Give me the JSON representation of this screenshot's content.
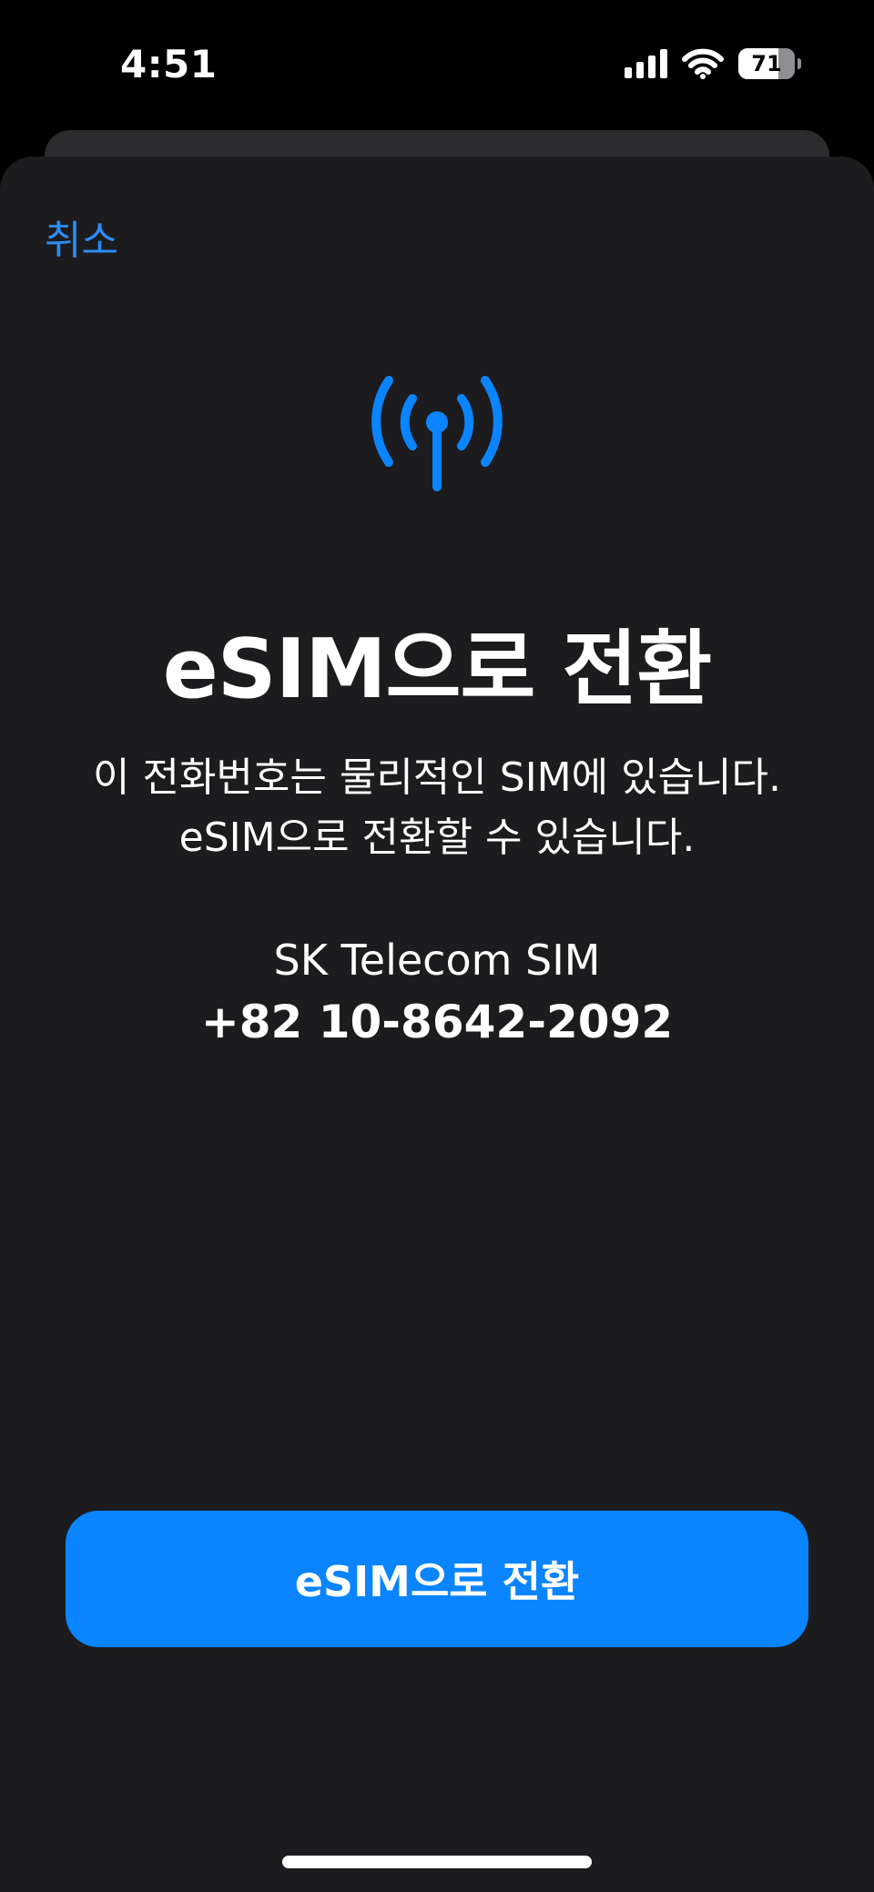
{
  "status_bar": {
    "time": "4:51",
    "battery_level": "71",
    "battery_fraction": 0.71,
    "signal_bars": 4,
    "icons": [
      "cellular-signal-icon",
      "wifi-icon",
      "battery-icon"
    ]
  },
  "sheet": {
    "cancel_label": "취소",
    "icon": "antenna-radiowaves-icon",
    "title": "eSIM으로 전환",
    "description_line1": "이 전화번호는 물리적인 SIM에 있습니다.",
    "description_line2": "eSIM으로 전환할 수 있습니다.",
    "carrier": "SK Telecom SIM",
    "phone_number": "+82 10-8642-2092",
    "primary_button_label": "eSIM으로 전환"
  },
  "colors": {
    "accent": "#0a84ff",
    "link": "#2b8cf5",
    "sheet_background": "#1c1c1e",
    "screen_background": "#000000"
  }
}
